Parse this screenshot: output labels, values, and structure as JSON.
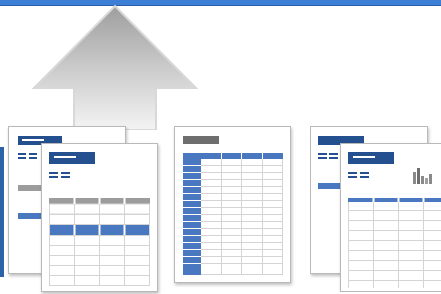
{
  "colors": {
    "accent_blue": "#24508f",
    "row_blue": "#4a78c0",
    "gray_header": "#9c9c9c",
    "dark_gray": "#6e6e6e",
    "grid_line": "#d4d4d4",
    "arrow_top": "#f2f2f2",
    "arrow_bottom": "#b0b0b0"
  },
  "icons": {
    "arrow": "up-arrow-icon",
    "chart": "bar-chart-icon"
  },
  "templates": [
    {
      "name": "report-template-group"
    },
    {
      "name": "table-template"
    },
    {
      "name": "chart-report-template-group"
    }
  ]
}
